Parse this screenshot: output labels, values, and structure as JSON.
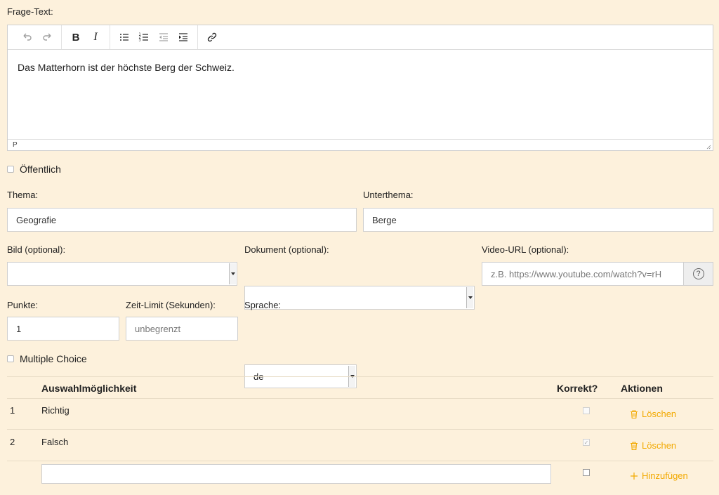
{
  "question": {
    "label": "Frage-Text:",
    "content": "Das Matterhorn ist der höchste Berg der Schweiz.",
    "status_path": "P"
  },
  "public": {
    "label": "Öffentlich"
  },
  "topic": {
    "label": "Thema:",
    "value": "Geografie"
  },
  "subtopic": {
    "label": "Unterthema:",
    "value": "Berge"
  },
  "image": {
    "label": "Bild (optional):",
    "value": ""
  },
  "document": {
    "label": "Dokument (optional):",
    "value": ""
  },
  "video": {
    "label": "Video-URL (optional):",
    "placeholder": "z.B. https://www.youtube.com/watch?v=rH",
    "help": "?"
  },
  "points": {
    "label": "Punkte:",
    "value": "1"
  },
  "time_limit": {
    "label": "Zeit-Limit (Sekunden):",
    "placeholder": "unbegrenzt"
  },
  "language": {
    "label": "Sprache:",
    "value": "de"
  },
  "multiple_choice": {
    "label": "Multiple Choice"
  },
  "table": {
    "col_option": "Auswahlmöglichkeit",
    "col_correct": "Korrekt?",
    "col_actions": "Aktionen",
    "rows": [
      {
        "num": "1",
        "text": "Richtig",
        "correct": false,
        "action": "Löschen"
      },
      {
        "num": "2",
        "text": "Falsch",
        "correct": true,
        "action": "Löschen"
      }
    ],
    "add_label": "Hinzufügen",
    "new_value": ""
  },
  "icons": {
    "undo": "undo-icon",
    "redo": "redo-icon",
    "bold": "B",
    "italic": "I",
    "bullet_list": "bullet-list-icon",
    "numbered_list": "numbered-list-icon",
    "outdent": "outdent-icon",
    "indent": "indent-icon",
    "link": "link-icon",
    "trash": "trash-icon",
    "plus": "plus-icon"
  },
  "colors": {
    "background": "#fdf1dc",
    "accent": "#f2a900"
  }
}
